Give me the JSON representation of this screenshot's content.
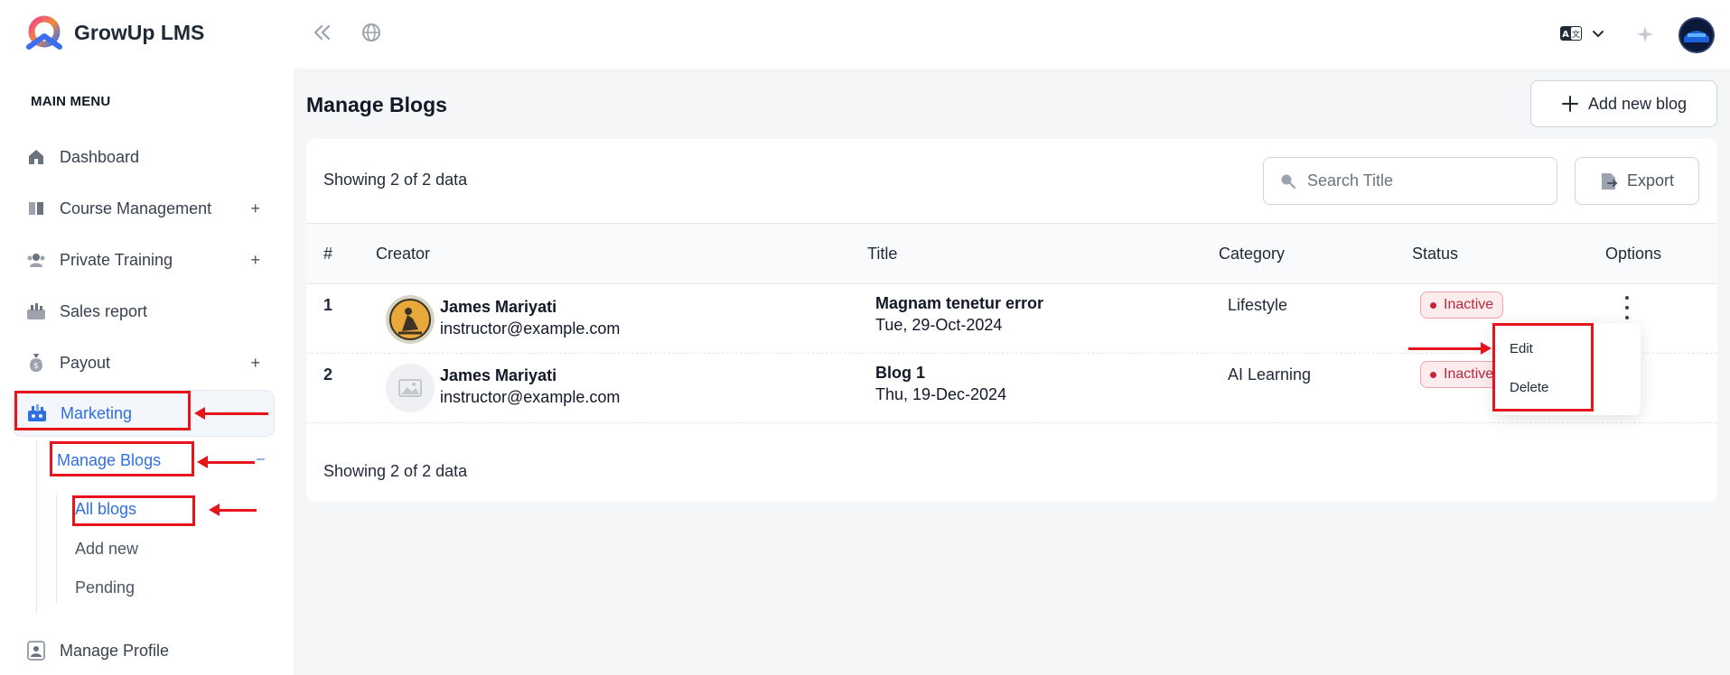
{
  "app": {
    "name": "GrowUp LMS"
  },
  "sidebar": {
    "heading": "MAIN MENU",
    "items": [
      {
        "label": "Dashboard",
        "icon": "home-icon",
        "expandable": false
      },
      {
        "label": "Course Management",
        "icon": "book-icon",
        "expandable": true,
        "toggle": "+"
      },
      {
        "label": "Private Training",
        "icon": "users-icon",
        "expandable": true,
        "toggle": "+"
      },
      {
        "label": "Sales report",
        "icon": "chart-icon",
        "expandable": false
      },
      {
        "label": "Payout",
        "icon": "money-bag-icon",
        "expandable": true,
        "toggle": "+"
      },
      {
        "label": "Marketing",
        "icon": "marketing-icon",
        "expandable": true,
        "active": true
      },
      {
        "label": "Manage Profile",
        "icon": "profile-icon",
        "expandable": false
      }
    ],
    "marketing_sub": {
      "label": "Manage Blogs",
      "toggle": "–",
      "children": [
        "All blogs",
        "Add new",
        "Pending"
      ]
    }
  },
  "topbar": {
    "icons": [
      "collapse-icon",
      "globe-icon",
      "translate-icon",
      "chevron-down-icon",
      "sparkle-icon",
      "user-avatar"
    ]
  },
  "main": {
    "title": "Manage Blogs",
    "add_button": "Add new blog",
    "showing_top": "Showing 2 of 2 data",
    "showing_bottom": "Showing 2 of 2 data",
    "search_placeholder": "Search Title",
    "export_label": "Export",
    "columns": [
      "#",
      "Creator",
      "Title",
      "Category",
      "Status",
      "Options"
    ],
    "rows": [
      {
        "num": "1",
        "creator_name": "James Mariyati",
        "creator_email": "instructor@example.com",
        "title": "Magnam tenetur error",
        "date": "Tue, 29-Oct-2024",
        "category": "Lifestyle",
        "status": "Inactive"
      },
      {
        "num": "2",
        "creator_name": "James Mariyati",
        "creator_email": "instructor@example.com",
        "title": "Blog 1",
        "date": "Thu, 19-Dec-2024",
        "category": "AI Learning",
        "status": "Inactive"
      }
    ],
    "options_menu": [
      "Edit",
      "Delete"
    ]
  },
  "colors": {
    "accent": "#2f6fe4",
    "annotation": "#e8141b",
    "inactive": "#c0263a"
  }
}
